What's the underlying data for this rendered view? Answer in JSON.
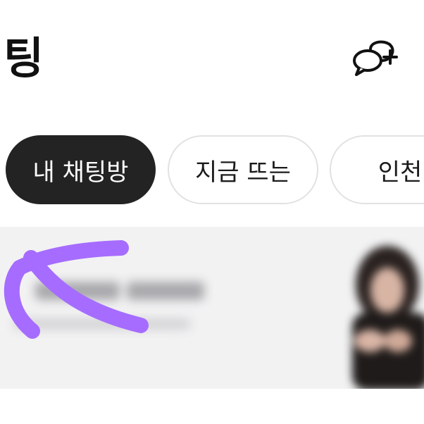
{
  "header": {
    "title": "채팅",
    "new_chat_icon": "chat-bubbles-plus-icon"
  },
  "filters": [
    {
      "label": "내 채팅방",
      "active": true
    },
    {
      "label": "지금 뜨는",
      "active": false
    },
    {
      "label": "인천",
      "active": false
    }
  ],
  "colors": {
    "chip_active_bg": "#232323",
    "chip_border": "#e2e2e2",
    "row_bg": "#f2f2f3",
    "annotation": "#a66cff"
  },
  "chat_row": {
    "thumbnail_icon": "profile-photo",
    "text_blurred": true
  },
  "annotation": {
    "icon": "purple-arrow-icon"
  }
}
